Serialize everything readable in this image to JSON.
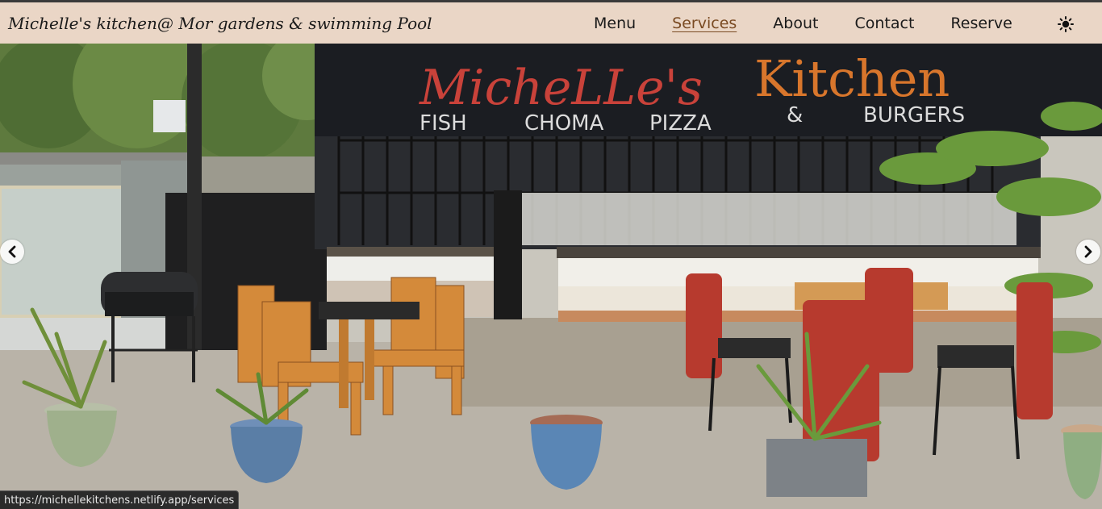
{
  "header": {
    "brand": "Michelle's kitchen@ Mor gardens & swimming Pool",
    "nav": [
      {
        "label": "Menu",
        "active": false
      },
      {
        "label": "Services",
        "active": true
      },
      {
        "label": "About",
        "active": false
      },
      {
        "label": "Contact",
        "active": false
      },
      {
        "label": "Reserve",
        "active": false
      }
    ],
    "theme_toggle_icon": "sun-icon"
  },
  "hero": {
    "sign_title": "MicheLLe's Kitchen",
    "sign_items": [
      "FISH",
      "CHOMA",
      "PIZZA",
      "&",
      "BURGERS"
    ],
    "prev_icon": "chevron-left-icon",
    "next_icon": "chevron-right-icon"
  },
  "status_bar": {
    "url": "https://michellekitchens.netlify.app/services"
  },
  "colors": {
    "navbar_bg": "#ead6c6",
    "active_link": "#7a4a22",
    "sign_red": "#c9423a",
    "sign_orange": "#d8762c"
  }
}
